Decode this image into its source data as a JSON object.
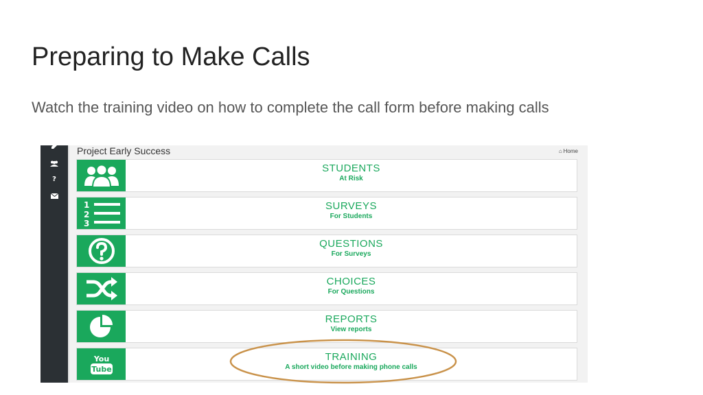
{
  "slide": {
    "title": "Preparing to Make Calls",
    "subtitle": "Watch the training video on how to complete the call form before making calls"
  },
  "app": {
    "title": "Project Early Success",
    "home_label": "Home",
    "sidebar_icons": [
      "edit-icon",
      "users-icon",
      "help-icon",
      "envelope-icon"
    ],
    "accent_color": "#1aa85c",
    "sidebar_color": "#2b3034",
    "tiles": [
      {
        "title": "STUDENTS",
        "subtitle": "At Risk",
        "icon": "users-icon"
      },
      {
        "title": "SURVEYS",
        "subtitle": "For Students",
        "icon": "numbered-list-icon"
      },
      {
        "title": "QUESTIONS",
        "subtitle": "For Surveys",
        "icon": "question-circle-icon"
      },
      {
        "title": "CHOICES",
        "subtitle": "For Questions",
        "icon": "shuffle-icon"
      },
      {
        "title": "REPORTS",
        "subtitle": "View reports",
        "icon": "pie-chart-icon"
      },
      {
        "title": "TRAINING",
        "subtitle": "A short video before making phone calls",
        "icon": "youtube-icon"
      }
    ],
    "youtube_icon_text": {
      "line1": "You",
      "line2": "Tube"
    }
  },
  "annotation": {
    "highlight_color": "#c9924a",
    "highlighted_tile": "TRAINING"
  }
}
